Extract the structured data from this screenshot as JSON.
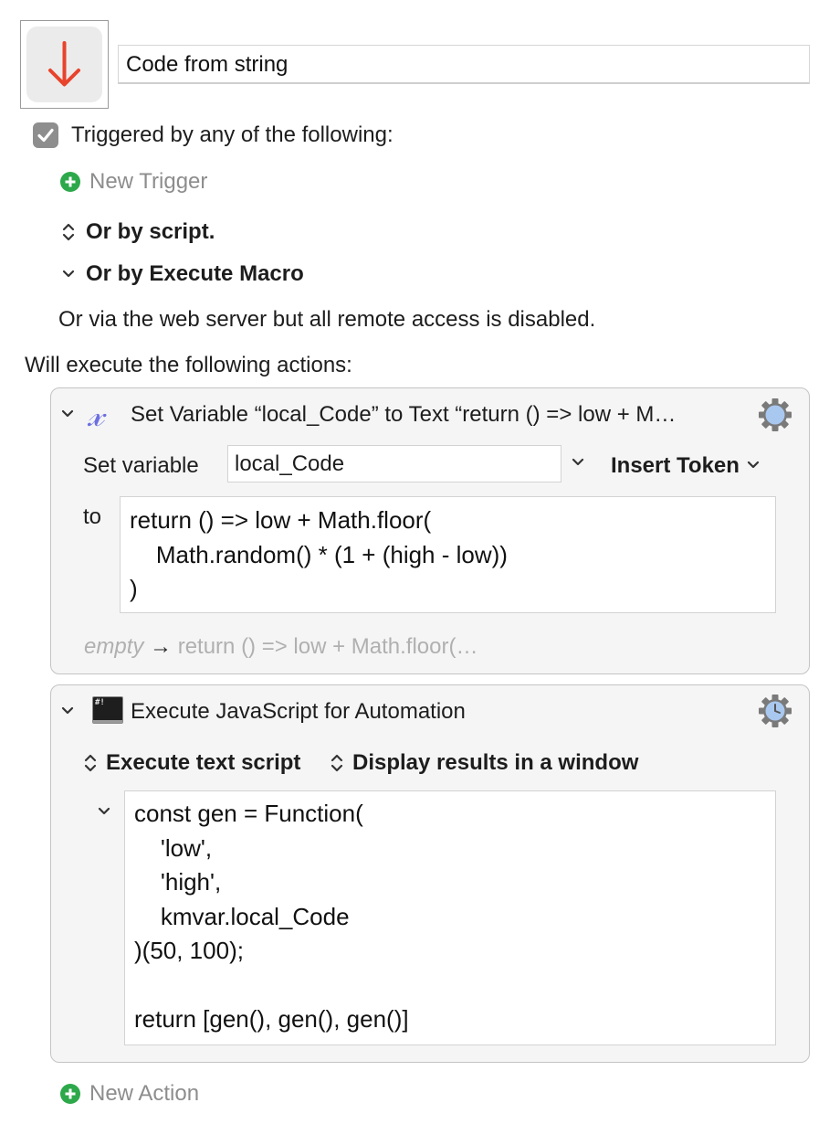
{
  "macro": {
    "name": "Code from string",
    "icon": "down-arrow-icon",
    "icon_color": "#e8432b"
  },
  "triggers": {
    "checkbox_label": "Triggered by any of the following:",
    "checked": true,
    "new_trigger": "New Trigger",
    "or_by_script": "Or by script.",
    "or_by_execute_macro": "Or by Execute Macro",
    "web_server_note": "Or via the web server but all remote access is disabled."
  },
  "actions_heading": "Will execute the following actions:",
  "action1": {
    "title": "Set Variable “local_Code” to Text “return () => low + M…",
    "set_variable_label": "Set variable",
    "variable_name": "local_Code",
    "insert_token": "Insert Token",
    "to_label": "to",
    "text_lines": [
      "return () => low + Math.floor(",
      "    Math.random() * (1 + (high - low))",
      ")"
    ],
    "preview_empty": "empty",
    "preview_arrow": "→",
    "preview_value": "return () => low + Math.floor(…"
  },
  "action2": {
    "title": "Execute JavaScript for Automation",
    "execute_mode": "Execute text script",
    "results_mode": "Display results in a window",
    "script_lines": [
      "const gen = Function(",
      "    'low',",
      "    'high',",
      "    kmvar.local_Code",
      ")(50, 100);",
      "",
      "return [gen(), gen(), gen()]"
    ]
  },
  "new_action": "New Action",
  "colors": {
    "accent_green": "#2da84a",
    "variable_icon_blue": "#6b6fe0",
    "gear_blue": "#a9c8f0"
  }
}
